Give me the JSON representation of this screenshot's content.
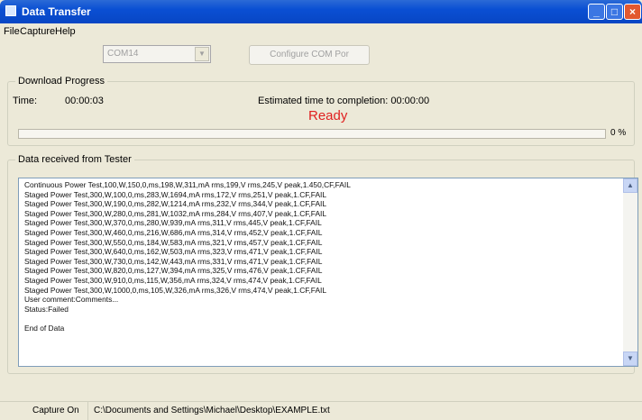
{
  "window": {
    "title": "Data Transfer"
  },
  "menu": {
    "items": [
      "File",
      "Capture",
      "Help"
    ]
  },
  "toolbar": {
    "com_port": "COM14",
    "configure_button": "Configure COM Por"
  },
  "download": {
    "group_label": "Download Progress",
    "time_label": "Time:",
    "time_value": "00:00:03",
    "estimated_label": "Estimated time to completion: 00:00:00",
    "status": "Ready",
    "progress_fraction": 0,
    "percent_text": "0 %"
  },
  "data": {
    "group_label": "Data received from Tester",
    "lines": [
      "Continuous Power Test,100,W,150,0,ms,198,W,311,mA rms,199,V rms,245,V peak,1.450,CF,FAIL",
      "Staged Power Test,300,W,100,0,ms,283,W,1694,mA rms,172,V rms,251,V peak,1.CF,FAIL",
      "Staged Power Test,300,W,190,0,ms,282,W,1214,mA rms,232,V rms,344,V peak,1.CF,FAIL",
      "Staged Power Test,300,W,280,0,ms,281,W,1032,mA rms,284,V rms,407,V peak,1.CF,FAIL",
      "Staged Power Test,300,W,370,0,ms,280,W,939,mA rms,311,V rms,445,V peak,1.CF,FAIL",
      "Staged Power Test,300,W,460,0,ms,216,W,686,mA rms,314,V rms,452,V peak,1.CF,FAIL",
      "Staged Power Test,300,W,550,0,ms,184,W,583,mA rms,321,V rms,457,V peak,1.CF,FAIL",
      "Staged Power Test,300,W,640,0,ms,162,W,503,mA rms,323,V rms,471,V peak,1.CF,FAIL",
      "Staged Power Test,300,W,730,0,ms,142,W,443,mA rms,331,V rms,471,V peak,1.CF,FAIL",
      "Staged Power Test,300,W,820,0,ms,127,W,394,mA rms,325,V rms,476,V peak,1.CF,FAIL",
      "Staged Power Test,300,W,910,0,ms,115,W,356,mA rms,324,V rms,474,V peak,1.CF,FAIL",
      "Staged Power Test,300,W,1000,0,ms,105,W,326,mA rms,326,V rms,474,V peak,1.CF,FAIL",
      "User comment:Comments...",
      "Status:Failed",
      "",
      "End of Data"
    ]
  },
  "statusbar": {
    "capture": "Capture On",
    "path": "C:\\Documents and Settings\\Michael\\Desktop\\EXAMPLE.txt"
  }
}
